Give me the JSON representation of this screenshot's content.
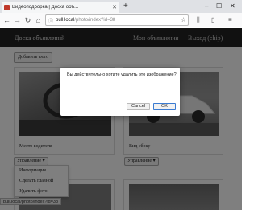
{
  "browser": {
    "tab_title": "Видеоподборка | Доска объ...",
    "new_tab": "+",
    "window_controls": [
      "–",
      "☐",
      "✕"
    ],
    "url_host": "bull.local",
    "url_path": "/photo/index?id=38",
    "toolbar_icons": [
      "back-icon",
      "forward-icon",
      "reload-icon",
      "home-icon",
      "library-icon",
      "sidebar-icon",
      "menu-icon"
    ]
  },
  "site": {
    "brand": "Доска объявлений",
    "nav_my_ads": "Мои объявления",
    "nav_logout": "Выход (chip)",
    "add_photo": "Добавить фото"
  },
  "cards": [
    {
      "caption": "Место водителя",
      "menu_button": "Управление ▾"
    },
    {
      "caption": "Вид сбоку",
      "menu_button": "Управление ▾"
    }
  ],
  "dropdown": {
    "items": [
      "Информация",
      "Сделать главной",
      "Удалить фото"
    ]
  },
  "status_url": "bull.local/photo/index?id=38",
  "dialog": {
    "message": "Вы действительно хотите удалить это изображение?",
    "cancel": "Cancel",
    "ok": "OK"
  },
  "colors": {
    "site_header": "#222222",
    "overlay": "rgba(0,0,0,0.5)",
    "ok_border": "#3b7bd1"
  }
}
